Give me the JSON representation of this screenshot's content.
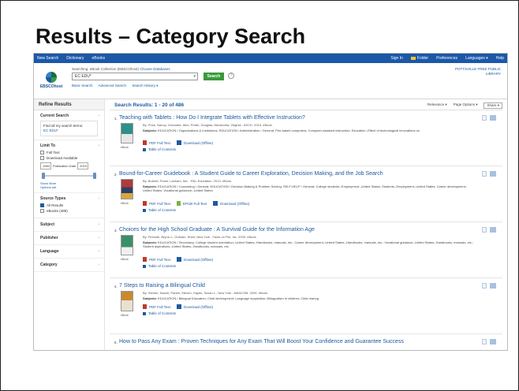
{
  "slide_title": "Results – Category Search",
  "topbar": {
    "left": [
      "New Search",
      "Dictionary",
      "eBooks"
    ],
    "right": [
      "Sign In",
      "Folder",
      "Preferences",
      "Languages ▾",
      "Help"
    ]
  },
  "header": {
    "logo_text": "EBSCOhost",
    "searching_prefix": "Searching: eBook Collection (EBSCOhost)",
    "choose_db": "Choose Databases",
    "query": "EC EDU*",
    "search_button": "Search",
    "help": "?",
    "sublinks": [
      "Basic Search",
      "Advanced Search",
      "Search History ▾"
    ],
    "library_name": "POTTSVILLE FREE PUBLIC LIBRARY"
  },
  "sidebar": {
    "refine_title": "Refine Results",
    "current_search_heading": "Current Search",
    "find_all_label": "Find all my search terms:",
    "find_all_term": "EC EDU*",
    "limit_to_heading": "Limit To",
    "limit_options": [
      {
        "label": "Full Text",
        "checked": false
      },
      {
        "label": "Download Available",
        "checked": false
      }
    ],
    "date_from": "1984",
    "date_label": "Publication Date",
    "date_to": "2015",
    "show_more": "Show More",
    "options_set": "Options set",
    "source_types_heading": "Source Types",
    "source_options": [
      {
        "label": "All Results",
        "checked": true
      },
      {
        "label": "eBooks (486)",
        "checked": false
      }
    ],
    "collapsed_sections": [
      "Subject",
      "Publisher",
      "Language",
      "Category"
    ]
  },
  "main": {
    "results_label": "Search Results: 1 - 20 of 486",
    "options": [
      "Relevance ▾",
      "Page Options ▾",
      "Share ▾"
    ],
    "results": [
      {
        "num": "1.",
        "title": "Teaching with Tablets : How Do I Integrate Tablets with Effective Instruction?",
        "meta": "By: Price, Nancy; Gonzalez, Alex; Porter, Douglas; Alexandria, Virginia : ASCD. 2015. eBook.",
        "subjects_label": "Subjects:",
        "subjects": "EDUCATION / Organizations & Institutions; EDUCATION / Administration / General; Pen-based computers; Computer-assisted instruction; Education--Effect of technological innovations on",
        "links": [
          "PDF Full Text",
          "Download (Offline)"
        ],
        "toc": "Table of Contents",
        "thumb_label": "eBook",
        "thumb_color": "#2f8f8a"
      },
      {
        "num": "2.",
        "title": "Bound-for-Career Guidebook : A Student Guide to Career Exploration, Decision Making, and the Job Search",
        "meta": "By: Burkett, Frank; Lanham, Md. : R&L Education. 2013. eBook.",
        "subjects_label": "Subjects:",
        "subjects": "EDUCATION / Counseling / General; EDUCATION / Decision-Making & Problem Solving; SELF-HELP / General; College students--Employment--United States; Students--Employment--United States; Career development--United States; Vocational guidance--United States",
        "links": [
          "PDF Full Text",
          "EPUB Full Text",
          "Download (Offline)"
        ],
        "toc": "Table of Contents",
        "thumb_label": "eBook",
        "thumb_color": "#b03a3a"
      },
      {
        "num": "3.",
        "title": "Choices for the High School Graduate : A Survival Guide for the Information Age",
        "meta": "By: Fireside, Bryna J.; Gotham, Sheri; New York : Facts on File, Inc. 2009. eBook.",
        "subjects_label": "Subjects:",
        "subjects": "EDUCATION / Secondary; College student orientation--United States--Handbooks, manuals, etc.; Career development--United States--Handbooks, manuals, etc.; Vocational guidance--United States--Handbooks, manuals, etc.; Student aspirations--United States--Handbooks, manuals, etc.",
        "links": [
          "PDF Full Text",
          "Download (Offline)"
        ],
        "toc": "Table of Contents",
        "thumb_label": "eBook",
        "thumb_color": "#3a8f6a"
      },
      {
        "num": "4.",
        "title": "7 Steps to Raising a Bilingual Child",
        "meta": "By: Steiner, Naomi; Parker, Steven; Hayes, Susan L.; New York : AMACOM. 2009. eBook.",
        "subjects_label": "Subjects:",
        "subjects": "EDUCATION / Bilingual Education; Child development; Language acquisition; Bilingualism in children; Child rearing",
        "links": [
          "PDF Full Text",
          "Download (Offline)"
        ],
        "toc": "Table of Contents",
        "thumb_label": "eBook",
        "thumb_color": "#c98a2e"
      },
      {
        "num": "5.",
        "title": "How to Pass Any Exam : Proven Techniques for Any Exam That Will Boost Your Confidence and Guarantee Success",
        "meta": "",
        "subjects_label": "",
        "subjects": "",
        "links": [],
        "toc": "",
        "thumb_label": "",
        "thumb_color": "#cccccc"
      }
    ]
  }
}
